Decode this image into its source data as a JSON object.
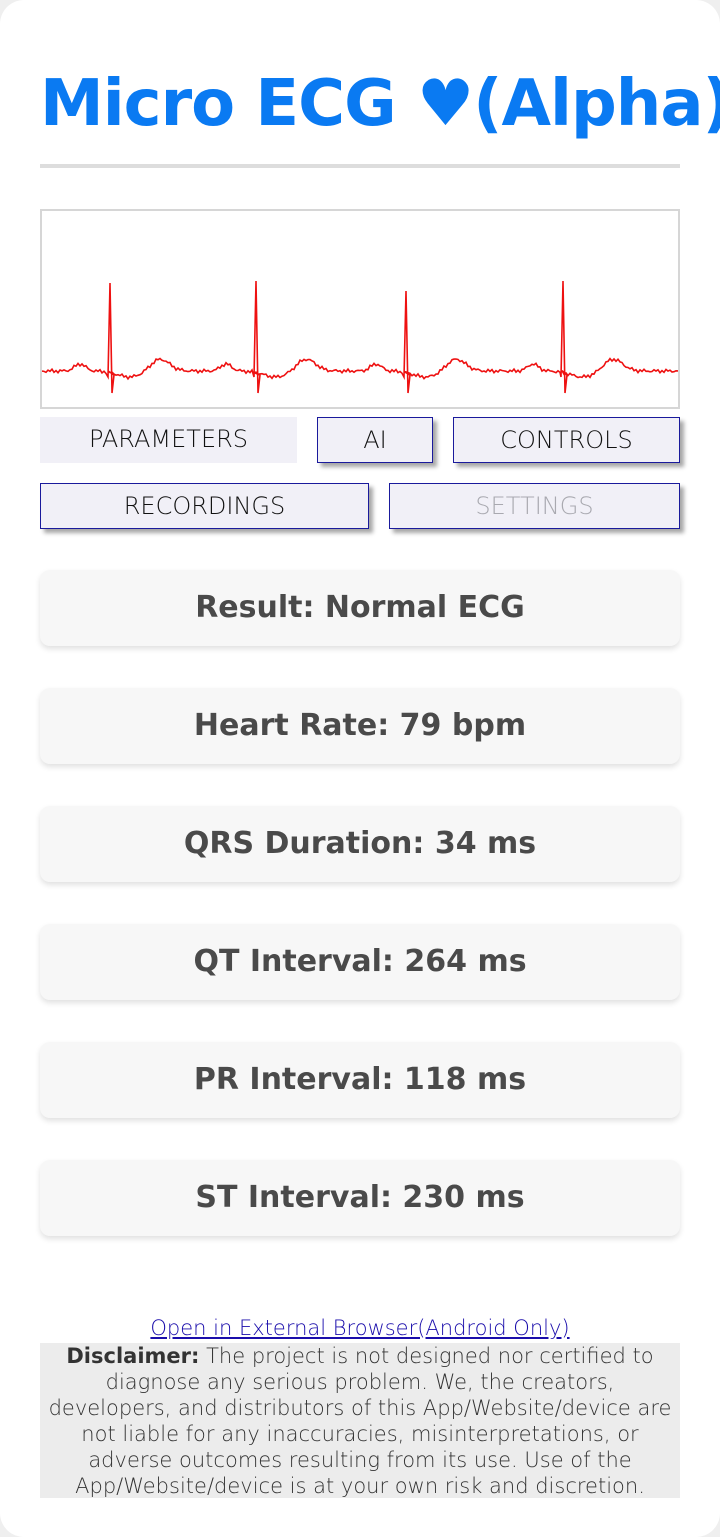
{
  "header": {
    "title": "Micro ECG ♥(Alpha)"
  },
  "ecg": {
    "trace_color": "#ee1111"
  },
  "tabs": {
    "parameters": "PARAMETERS",
    "ai": "AI",
    "controls": "CONTROLS",
    "recordings": "RECORDINGS",
    "settings": "SETTINGS"
  },
  "results": [
    {
      "label": "Result: Normal ECG"
    },
    {
      "label": "Heart Rate: 79 bpm"
    },
    {
      "label": "QRS Duration: 34 ms"
    },
    {
      "label": "QT Interval: 264 ms"
    },
    {
      "label": "PR Interval: 118 ms"
    },
    {
      "label": "ST Interval: 230 ms"
    }
  ],
  "footer": {
    "external_link": "Open in External Browser(Android Only)",
    "disclaimer_label": "Disclaimer:",
    "disclaimer_text": " The project is not designed nor certified to diagnose any serious problem. We, the creators, developers, and distributors of this App/Website/device are not liable for any inaccuracies, misinterpretations, or adverse outcomes resulting from its use. Use of the App/Website/device is at your own risk and discretion."
  },
  "colors": {
    "accent": "#0a7af2",
    "tab_border": "#1a1a9c",
    "link": "#1a0dab"
  }
}
